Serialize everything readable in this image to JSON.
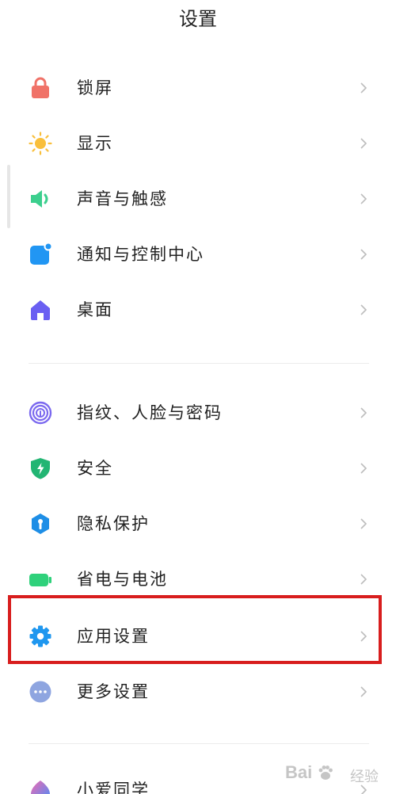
{
  "header": {
    "title": "设置"
  },
  "items": [
    {
      "label": "锁屏",
      "icon": "lock-icon",
      "color": "#f07268"
    },
    {
      "label": "显示",
      "icon": "sun-icon",
      "color": "#f9bf3b"
    },
    {
      "label": "声音与触感",
      "icon": "speaker-icon",
      "color": "#3ccf8e"
    },
    {
      "label": "通知与控制中心",
      "icon": "notification-icon",
      "color": "#2196f3"
    },
    {
      "label": "桌面",
      "icon": "home-icon",
      "color": "#6a5ff2"
    },
    {
      "label": "指纹、人脸与密码",
      "icon": "fingerprint-icon",
      "color": "#7b69ef"
    },
    {
      "label": "安全",
      "icon": "shield-icon",
      "color": "#22b573"
    },
    {
      "label": "隐私保护",
      "icon": "privacy-icon",
      "color": "#1e8ee6"
    },
    {
      "label": "省电与电池",
      "icon": "battery-icon",
      "color": "#2fd17b"
    },
    {
      "label": "应用设置",
      "icon": "gear-icon",
      "color": "#1f97ef"
    },
    {
      "label": "更多设置",
      "icon": "more-icon",
      "color": "#8ea5e0"
    },
    {
      "label": "小爱同学",
      "icon": "xiaoai-icon",
      "color": "#4a8df8"
    }
  ],
  "watermark": {
    "brand": "Bai",
    "sub": "经验"
  },
  "highlight_color": "#d81e1e"
}
